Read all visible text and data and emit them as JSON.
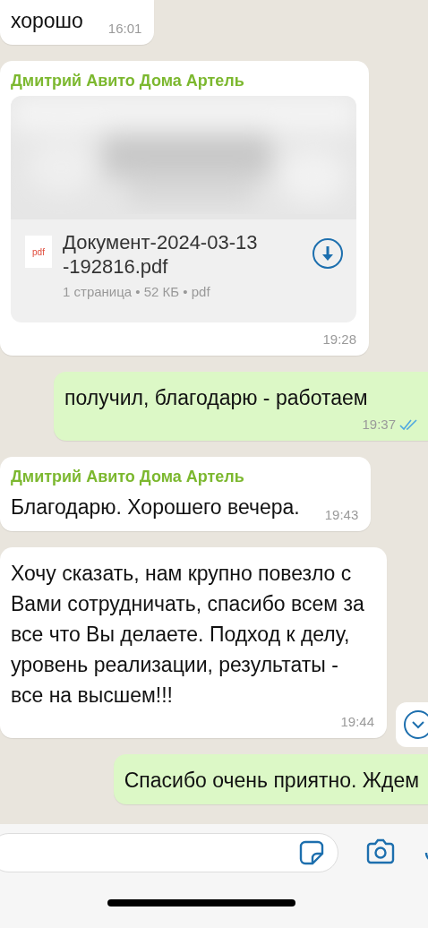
{
  "messages": [
    {
      "kind": "text",
      "outgoing": false,
      "text": "хорошо",
      "time": "16:01"
    },
    {
      "kind": "document",
      "outgoing": false,
      "sender": "Дмитрий Авито Дома Артель",
      "file_icon_label": "pdf",
      "file_name": "Документ-2024-03-13\n-192816.pdf",
      "file_meta": "1 страница • 52 КБ • pdf",
      "time": "19:28"
    },
    {
      "kind": "text",
      "outgoing": true,
      "text": "получил, благодарю - работаем",
      "time": "19:37",
      "read": true
    },
    {
      "kind": "text",
      "outgoing": false,
      "sender": "Дмитрий Авито Дома Артель",
      "text": "Благодарю. Хорошего вечера.",
      "time": "19:43"
    },
    {
      "kind": "text",
      "outgoing": false,
      "text": "Хочу сказать, нам крупно повезло с Вами сотрудничать, спасибо всем за все что Вы делаете. Подход к делу, уровень реализации, результаты - все на высшем!!!",
      "time": "19:44"
    },
    {
      "kind": "text",
      "outgoing": true,
      "text": "Спасибо очень приятно. Ждем"
    }
  ]
}
